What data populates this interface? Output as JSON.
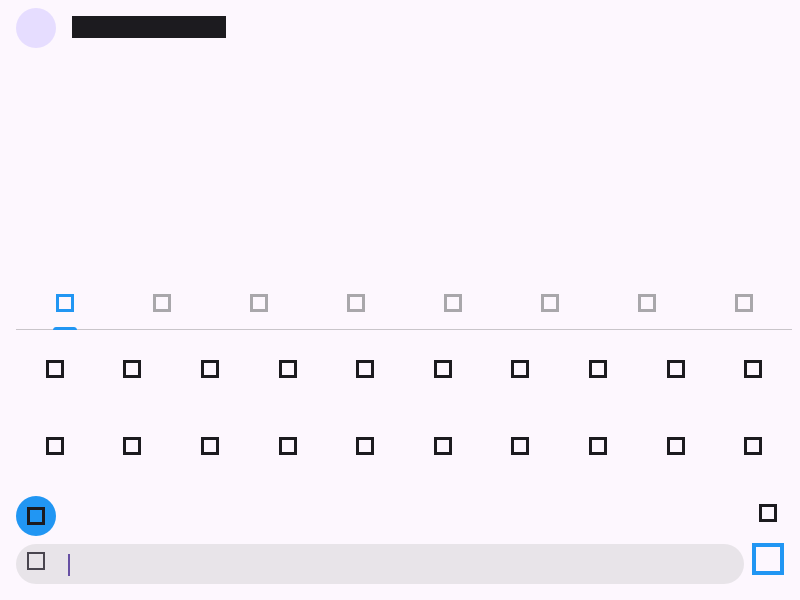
{
  "header": {
    "title": ""
  },
  "tabs": [
    {
      "icon": "emoji-category-icon",
      "active": true
    },
    {
      "icon": "emoji-category-icon",
      "active": false
    },
    {
      "icon": "emoji-category-icon",
      "active": false
    },
    {
      "icon": "emoji-category-icon",
      "active": false
    },
    {
      "icon": "emoji-category-icon",
      "active": false
    },
    {
      "icon": "emoji-category-icon",
      "active": false
    },
    {
      "icon": "emoji-category-icon",
      "active": false
    },
    {
      "icon": "emoji-category-icon",
      "active": false
    }
  ],
  "grid": {
    "rows": 2,
    "columns": 10,
    "icon": "emoji-glyph-icon"
  },
  "toolbar": {
    "fab_icon": "emoji-toggle-icon",
    "right_icon": "backspace-icon"
  },
  "input": {
    "value": "",
    "placeholder": "",
    "leading_icon": "emoji-icon"
  },
  "send": {
    "icon": "send-icon"
  },
  "colors": {
    "background": "#fdf7fe",
    "accent": "#2196f3",
    "avatar": "#e6ddff",
    "text": "#1c1b1f",
    "muted": "#a9a7ab",
    "input_bg": "#e8e4e9",
    "divider": "#c9c5ca"
  }
}
